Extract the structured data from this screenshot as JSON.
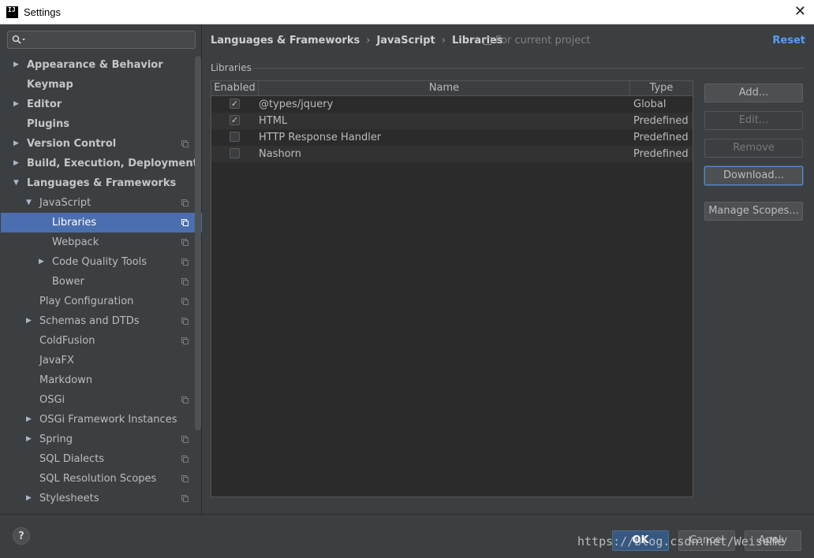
{
  "window": {
    "title": "Settings",
    "app_icon": "IJ"
  },
  "sidebar": {
    "search_placeholder": "",
    "items": [
      {
        "label": "Appearance & Behavior",
        "bold": true,
        "level": 0,
        "arrow": "right",
        "copy": false
      },
      {
        "label": "Keymap",
        "bold": true,
        "level": 0,
        "arrow": "",
        "copy": false
      },
      {
        "label": "Editor",
        "bold": true,
        "level": 0,
        "arrow": "right",
        "copy": false
      },
      {
        "label": "Plugins",
        "bold": true,
        "level": 0,
        "arrow": "",
        "copy": false
      },
      {
        "label": "Version Control",
        "bold": true,
        "level": 0,
        "arrow": "right",
        "copy": true
      },
      {
        "label": "Build, Execution, Deployment",
        "bold": true,
        "level": 0,
        "arrow": "right",
        "copy": false
      },
      {
        "label": "Languages & Frameworks",
        "bold": true,
        "level": 0,
        "arrow": "down",
        "copy": false
      },
      {
        "label": "JavaScript",
        "bold": false,
        "level": 1,
        "arrow": "down",
        "copy": true
      },
      {
        "label": "Libraries",
        "bold": false,
        "level": 2,
        "arrow": "",
        "copy": true,
        "selected": true
      },
      {
        "label": "Webpack",
        "bold": false,
        "level": 2,
        "arrow": "",
        "copy": true
      },
      {
        "label": "Code Quality Tools",
        "bold": false,
        "level": 2,
        "arrow": "right",
        "copy": true
      },
      {
        "label": "Bower",
        "bold": false,
        "level": 2,
        "arrow": "",
        "copy": true
      },
      {
        "label": "Play Configuration",
        "bold": false,
        "level": 1,
        "arrow": "",
        "copy": true
      },
      {
        "label": "Schemas and DTDs",
        "bold": false,
        "level": 1,
        "arrow": "right",
        "copy": true
      },
      {
        "label": "ColdFusion",
        "bold": false,
        "level": 1,
        "arrow": "",
        "copy": true
      },
      {
        "label": "JavaFX",
        "bold": false,
        "level": 1,
        "arrow": "",
        "copy": false
      },
      {
        "label": "Markdown",
        "bold": false,
        "level": 1,
        "arrow": "",
        "copy": false
      },
      {
        "label": "OSGi",
        "bold": false,
        "level": 1,
        "arrow": "",
        "copy": true
      },
      {
        "label": "OSGi Framework Instances",
        "bold": false,
        "level": 1,
        "arrow": "right",
        "copy": false
      },
      {
        "label": "Spring",
        "bold": false,
        "level": 1,
        "arrow": "right",
        "copy": true
      },
      {
        "label": "SQL Dialects",
        "bold": false,
        "level": 1,
        "arrow": "",
        "copy": true
      },
      {
        "label": "SQL Resolution Scopes",
        "bold": false,
        "level": 1,
        "arrow": "",
        "copy": true
      },
      {
        "label": "Stylesheets",
        "bold": false,
        "level": 1,
        "arrow": "right",
        "copy": true
      }
    ]
  },
  "header": {
    "breadcrumb": [
      "Languages & Frameworks",
      "JavaScript",
      "Libraries"
    ],
    "scope_note": "For current project",
    "reset_label": "Reset"
  },
  "libraries": {
    "section_title": "Libraries",
    "columns": [
      "Enabled",
      "Name",
      "Type"
    ],
    "rows": [
      {
        "enabled": true,
        "name": "@types/jquery",
        "type": "Global"
      },
      {
        "enabled": true,
        "name": "HTML",
        "type": "Predefined"
      },
      {
        "enabled": false,
        "name": "HTTP Response Handler",
        "type": "Predefined"
      },
      {
        "enabled": false,
        "name": "Nashorn",
        "type": "Predefined"
      }
    ]
  },
  "buttons": {
    "add": "Add...",
    "edit": "Edit...",
    "remove": "Remove",
    "download": "Download...",
    "manage_scopes": "Manage Scopes..."
  },
  "footer": {
    "help": "?",
    "ok": "OK",
    "cancel": "Cancel",
    "apply": "Apply",
    "watermark": "https://blog.csdn.net/WeiseMe"
  },
  "colors": {
    "background": "#3c3f41",
    "selection": "#4b6eaf",
    "link": "#589df6",
    "table_bg": "#2b2b2b"
  }
}
